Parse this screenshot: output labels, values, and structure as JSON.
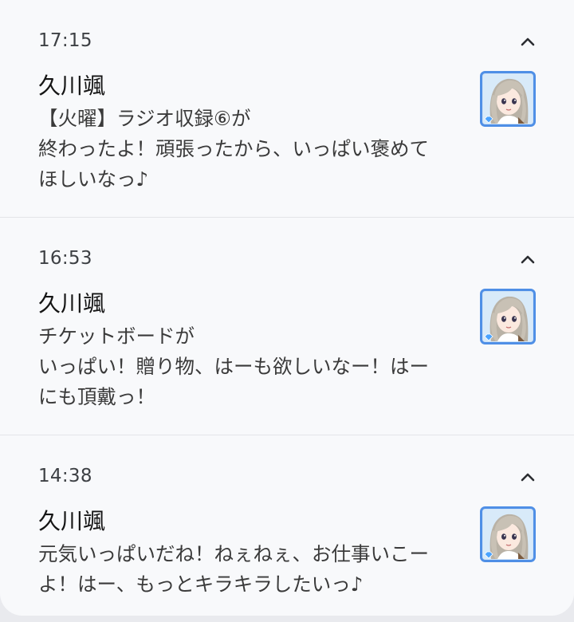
{
  "notifications": [
    {
      "time": "17:15",
      "sender": "久川颯",
      "lines": [
        "【火曜】ラジオ収録⑥が",
        "終わったよ！頑張ったから、いっぱい褒めて",
        "ほしいなっ♪"
      ],
      "avatar_icon": "character-portrait-icon",
      "collapse_icon": "chevron-up-icon"
    },
    {
      "time": "16:53",
      "sender": "久川颯",
      "lines": [
        "チケットボードが",
        "いっぱい！贈り物、はーも欲しいなー！はー",
        "にも頂戴っ！"
      ],
      "avatar_icon": "character-portrait-icon",
      "collapse_icon": "chevron-up-icon"
    },
    {
      "time": "14:38",
      "sender": "久川颯",
      "lines": [
        "元気いっぱいだね！ねぇねぇ、お仕事いこー",
        "よ！はー、もっとキラキラしたいっ♪"
      ],
      "avatar_icon": "character-portrait-icon",
      "collapse_icon": "chevron-up-icon"
    }
  ],
  "colors": {
    "panel_bg": "#f8f9fb",
    "avatar_border": "#4f8fe6",
    "divider": "#e3e4e8"
  }
}
